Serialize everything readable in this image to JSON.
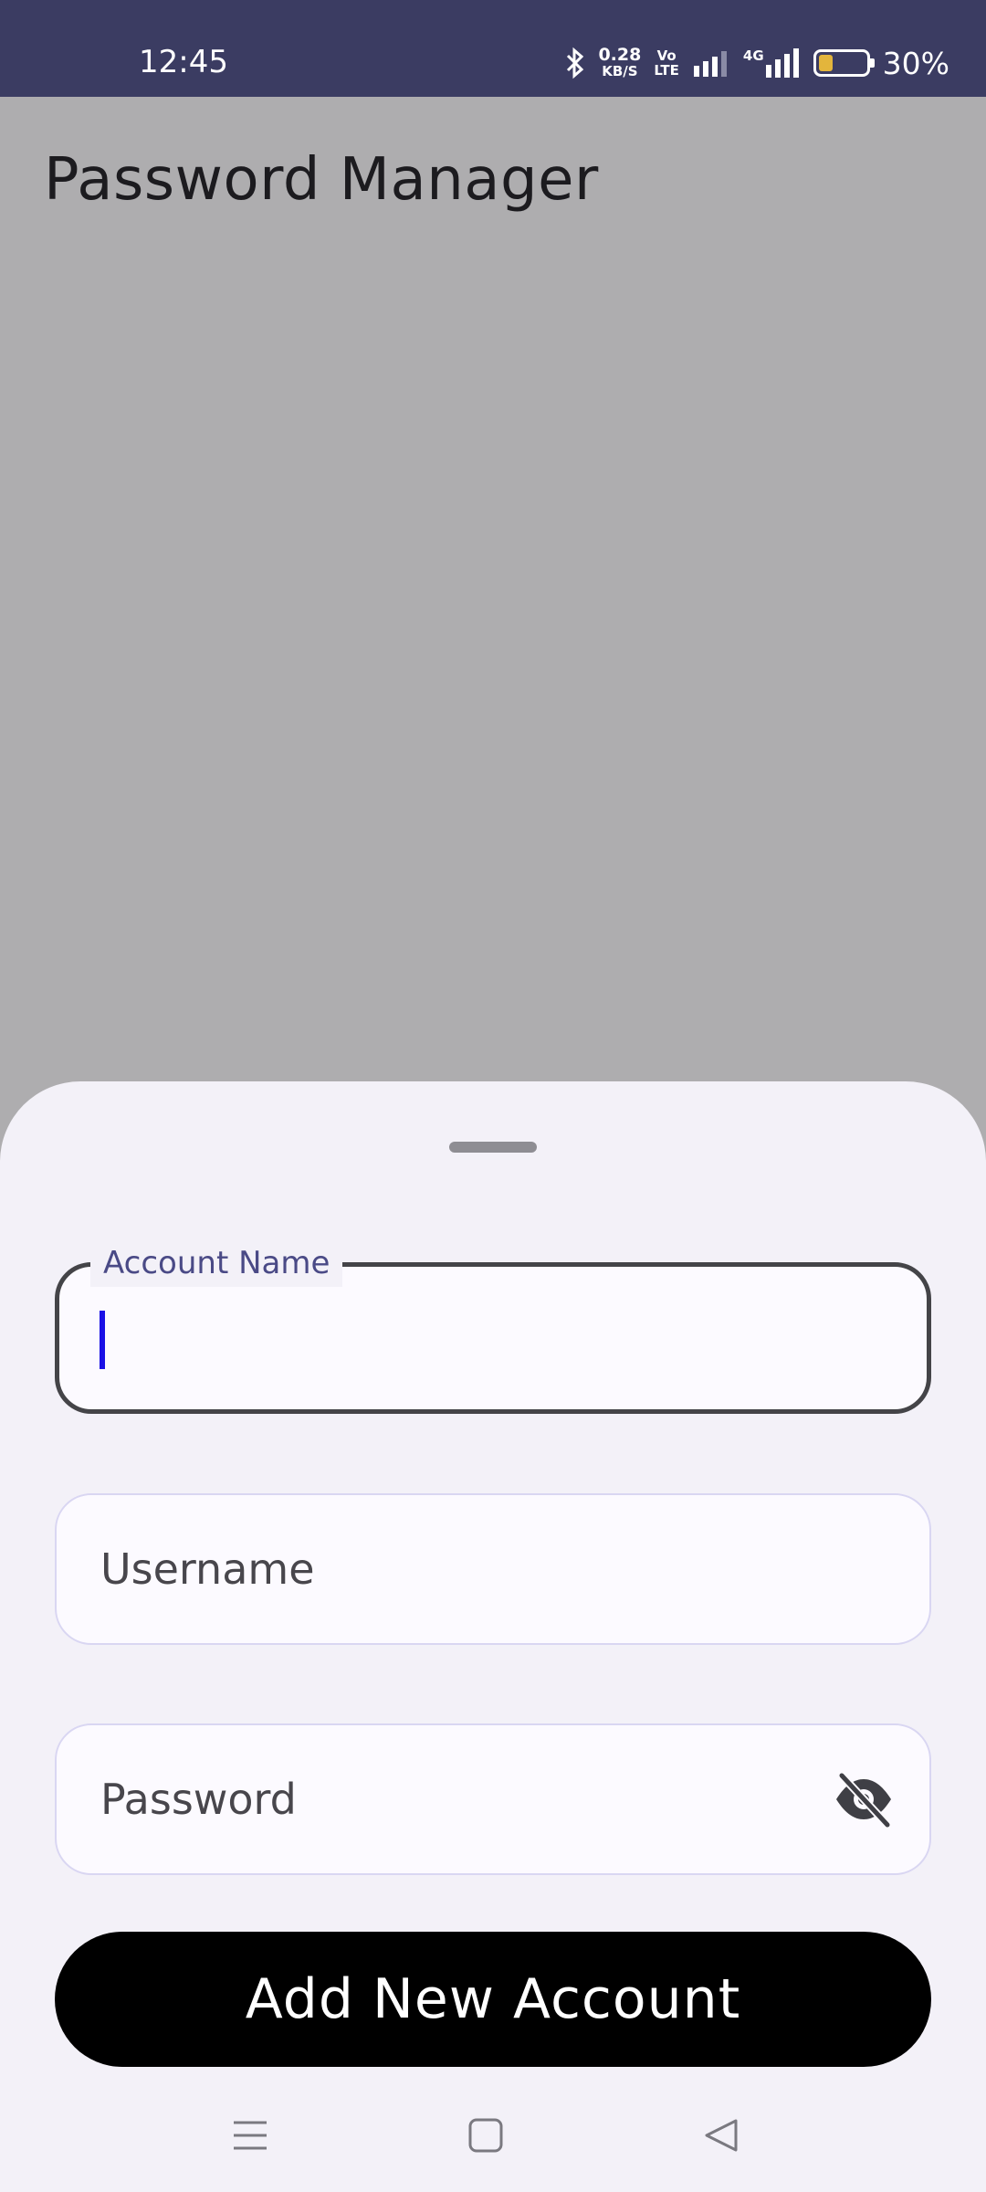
{
  "status_bar": {
    "time": "12:45",
    "net_speed_value": "0.28",
    "net_speed_unit": "KB/S",
    "volte_top": "Vo",
    "volte_bottom": "LTE",
    "network_type": "4G",
    "battery_percent_label": "30%",
    "battery_level": 0.3,
    "battery_color": "#e3b53c",
    "background_color": "#3b3c62"
  },
  "app": {
    "title": "Password Manager"
  },
  "form": {
    "account_name_label": "Account Name",
    "account_name_value": "",
    "username_placeholder": "Username",
    "password_placeholder": "Password",
    "password_visibility_icon": "eye-off-icon",
    "submit_label": "Add New Account"
  },
  "nav": {
    "recents_icon": "menu-icon",
    "home_icon": "square-icon",
    "back_icon": "triangle-back-icon"
  }
}
